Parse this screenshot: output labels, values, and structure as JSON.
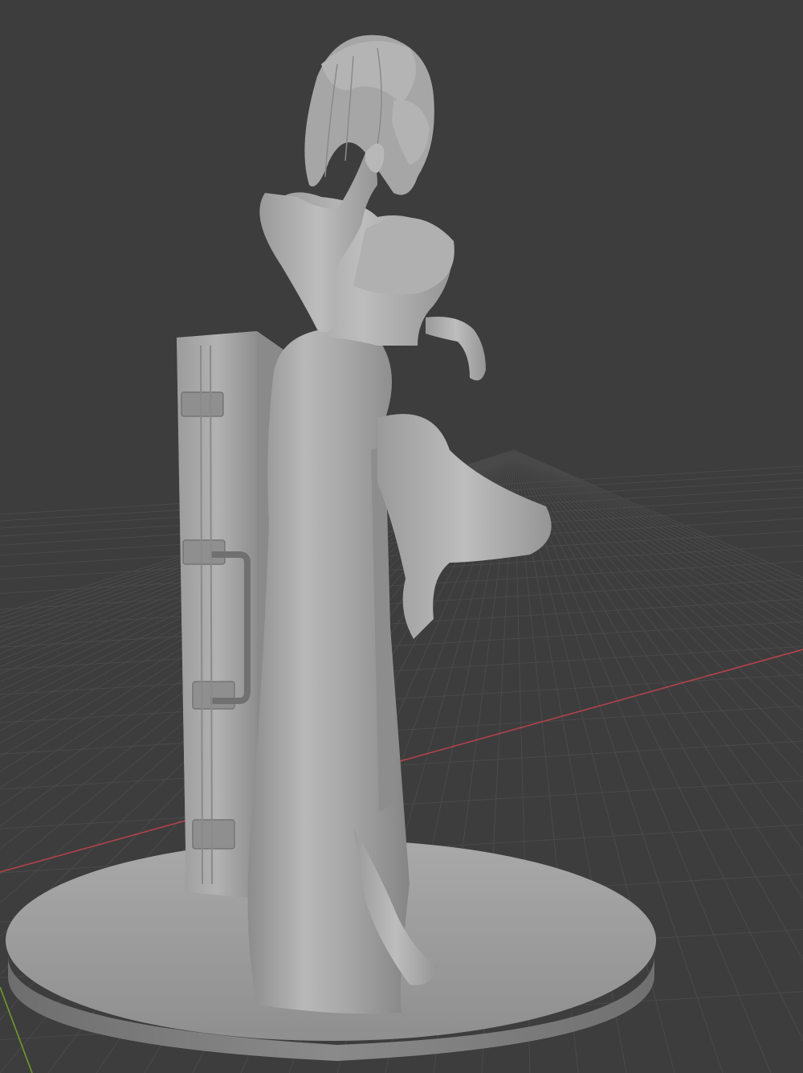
{
  "viewport": {
    "background": "#3d3d3d",
    "grid_color": "#4a4a4a",
    "x_axis_color": "#b3424a",
    "y_axis_color": "#6f9a2a",
    "mesh_color": "#9c9c9c"
  },
  "scene": {
    "objects": [
      "base-disc",
      "suitcase",
      "figure"
    ]
  }
}
